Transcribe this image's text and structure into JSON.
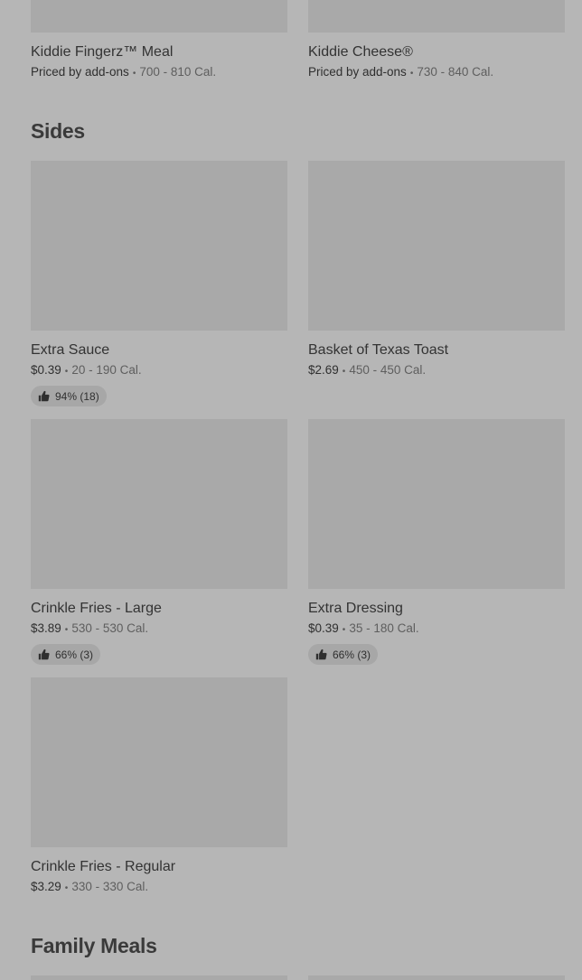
{
  "sections": {
    "kids": {
      "items": [
        {
          "name": "Kiddie Fingerz™ Meal",
          "price": "Priced by add-ons",
          "cal": "700 - 810 Cal."
        },
        {
          "name": "Kiddie Cheese®",
          "price": "Priced by add-ons",
          "cal": "730 - 840 Cal."
        }
      ]
    },
    "sides": {
      "title": "Sides",
      "items": [
        {
          "name": "Extra Sauce",
          "price": "$0.39",
          "cal": "20 - 190 Cal.",
          "rating": "94% (18)"
        },
        {
          "name": "Basket of Texas Toast",
          "price": "$2.69",
          "cal": "450 - 450 Cal."
        },
        {
          "name": "Crinkle Fries - Large",
          "price": "$3.89",
          "cal": "530 - 530 Cal.",
          "rating": "66% (3)"
        },
        {
          "name": "Extra Dressing",
          "price": "$0.39",
          "cal": "35 - 180 Cal.",
          "rating": "66% (3)"
        },
        {
          "name": "Crinkle Fries - Regular",
          "price": "$3.29",
          "cal": "330 - 330 Cal."
        }
      ]
    },
    "family": {
      "title": "Family Meals"
    }
  },
  "separator": "•",
  "icons": {
    "rating": "thumbs-up-icon"
  },
  "colors": {
    "background": "#b6b6b6",
    "placeholder": "#a9a9a9",
    "chip": "#a7a7a7"
  }
}
